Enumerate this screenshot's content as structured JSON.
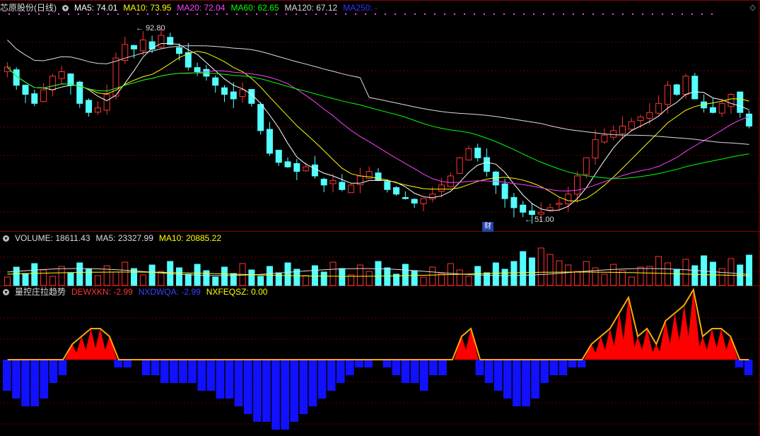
{
  "main_header": {
    "stock_name": "芯原股份(日线)",
    "ma5": "MA5: 74.01",
    "ma10": "MA10: 73.95",
    "ma20": "MA20: 72.04",
    "ma60": "MA60: 62.65",
    "ma120": "MA120: 67.12",
    "ma250": "MA250: -"
  },
  "volume_header": {
    "title": "VOLUME: 18611.43",
    "ma5": "MA5: 23327.99",
    "ma10": "MA10: 20885.22"
  },
  "indicator_header": {
    "title": "量控庄拉趋势",
    "dewxkn": "DEWXKN: -2.99",
    "nxdwqa": "NXDWQA: -2.99",
    "nxfeqsz": "NXFEQSZ: 0.00"
  },
  "annotations": {
    "high_price": "92.80",
    "low_price": "51.00",
    "event_marker": "财"
  },
  "colors": {
    "up": "#ff3333",
    "down": "#54ffff",
    "ma5": "#ffffff",
    "ma10": "#ffff00",
    "ma20": "#ff40ff",
    "ma60": "#00ff00",
    "ma120": "#dddddd",
    "ma250": "#3333ff",
    "indicator_pos": "#ff0000",
    "indicator_neg": "#1111ff",
    "indicator_line": "#ffaa00",
    "grid": "#8b0000"
  },
  "chart_data": {
    "type": "candlestick",
    "price_high": 92.8,
    "price_low": 51.0,
    "volume_last": 18611.43,
    "volume_ma5": 23327.99,
    "volume_ma10": 20885.22,
    "ma_values": {
      "MA5": 74.01,
      "MA10": 73.95,
      "MA20": 72.04,
      "MA60": 62.65,
      "MA120": 67.12
    },
    "close_path": [
      84,
      80,
      78,
      76,
      79,
      82,
      83,
      80,
      76,
      74,
      75,
      78,
      86,
      89,
      88,
      90,
      88,
      91,
      89,
      87,
      84,
      83,
      82,
      80,
      78,
      77,
      79,
      76,
      70,
      65,
      63,
      62,
      61,
      62,
      60,
      58,
      59,
      57,
      58,
      60,
      61,
      59,
      57,
      56,
      55,
      54,
      55,
      56,
      58,
      60,
      64,
      66,
      64,
      61,
      58,
      55,
      53,
      52,
      51.5,
      52,
      53,
      54,
      56,
      60,
      64,
      68,
      69,
      70,
      71,
      72,
      73,
      74,
      76,
      80,
      78,
      82,
      77,
      75,
      74,
      76,
      78,
      74,
      71
    ],
    "indicator_values": [
      -4,
      -5,
      -6,
      -6,
      -5,
      -3,
      -2,
      2,
      3,
      4,
      4,
      3,
      -1,
      -1,
      0,
      -2,
      -2,
      -3,
      -3,
      -3,
      -3,
      -4,
      -4,
      -5,
      -5,
      -6,
      -7,
      -8,
      -8,
      -9,
      -9,
      -8,
      -7,
      -6,
      -5,
      -4,
      -3,
      -2,
      -1,
      -1,
      0,
      -1,
      -2,
      -3,
      -3,
      -4,
      -2,
      -2,
      0,
      3,
      4,
      -2,
      -3,
      -4,
      -5,
      -6,
      -6,
      -5,
      -3,
      -2,
      -2,
      -1,
      -1,
      2,
      3,
      4,
      6,
      8,
      3,
      4,
      2,
      5,
      6,
      7,
      9,
      3,
      4,
      4,
      3,
      -1,
      -2
    ]
  }
}
